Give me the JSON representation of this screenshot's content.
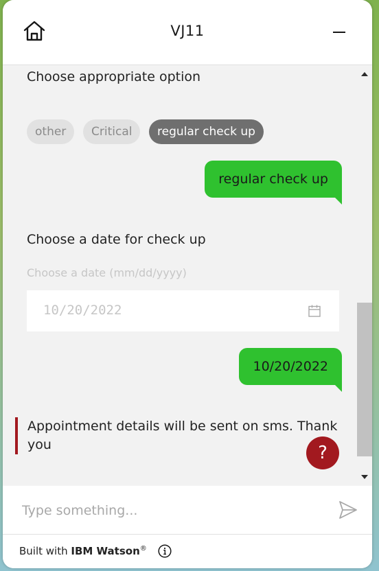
{
  "header": {
    "title": "VJ11",
    "home_icon": "home-icon",
    "minimize_icon": "minimize-icon"
  },
  "conversation": {
    "prompt_option": "Choose appropriate option",
    "options": [
      {
        "label": "other",
        "selected": false
      },
      {
        "label": "Critical",
        "selected": false
      },
      {
        "label": "regular check up",
        "selected": true
      }
    ],
    "user_reply_1": "regular check up",
    "prompt_date": "Choose a date for check up",
    "date_field_label": "Choose a date (mm/dd/yyyy)",
    "date_field_value": "10/20/2022",
    "user_reply_2": "10/20/2022",
    "final_message": "Appointment details will be sent on sms. Thank you"
  },
  "help": {
    "label": "?"
  },
  "composer": {
    "placeholder": "Type something...",
    "send_icon": "send-icon"
  },
  "footer": {
    "prefix": "Built with ",
    "brand": "IBM Watson",
    "registered": "®",
    "info_icon": "info-icon"
  },
  "colors": {
    "user_bubble": "#2fc12f",
    "selected_chip": "#6f6f6f",
    "accent_red": "#a2191f"
  }
}
